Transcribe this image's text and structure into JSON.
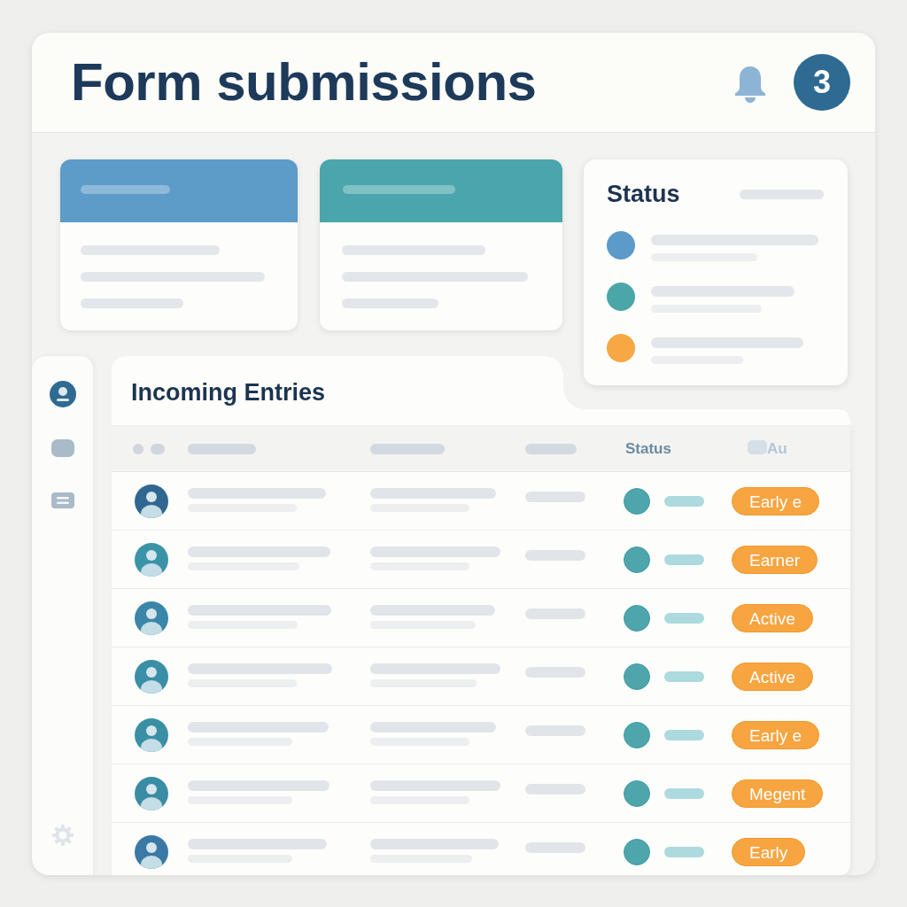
{
  "header": {
    "title": "Form submissions",
    "notification_count": "3"
  },
  "summary_cards": [
    {
      "color": "#5d9bc8"
    },
    {
      "color": "#4aa6ac"
    }
  ],
  "status_card": {
    "title": "Status",
    "items": [
      {
        "color": "#5b9ac9"
      },
      {
        "color": "#4aa6a8"
      },
      {
        "color": "#f7a743"
      }
    ]
  },
  "sidebar": {
    "items": [
      {
        "kind": "profile",
        "selected": true
      },
      {
        "kind": "tile",
        "selected": false
      },
      {
        "kind": "list",
        "selected": false
      }
    ]
  },
  "entries": {
    "title": "Incoming Entries",
    "header": {
      "status": "Status",
      "column_6": "Au"
    },
    "rows": [
      {
        "avatar": {
          "color": "#2f6791"
        },
        "tag": "Early e"
      },
      {
        "avatar": {
          "color": "#3a93a6"
        },
        "tag": "Earner"
      },
      {
        "avatar": {
          "color": "#3a86a8"
        },
        "tag": "Active"
      },
      {
        "avatar": {
          "color": "#3a8ea6"
        },
        "tag": "Active"
      },
      {
        "avatar": {
          "color": "#3a8fa5"
        },
        "tag": "Early e"
      },
      {
        "avatar": {
          "color": "#3a8ca5"
        },
        "tag": "Megent"
      },
      {
        "avatar": {
          "color": "#3a78a5"
        },
        "tag": "Early"
      }
    ]
  }
}
